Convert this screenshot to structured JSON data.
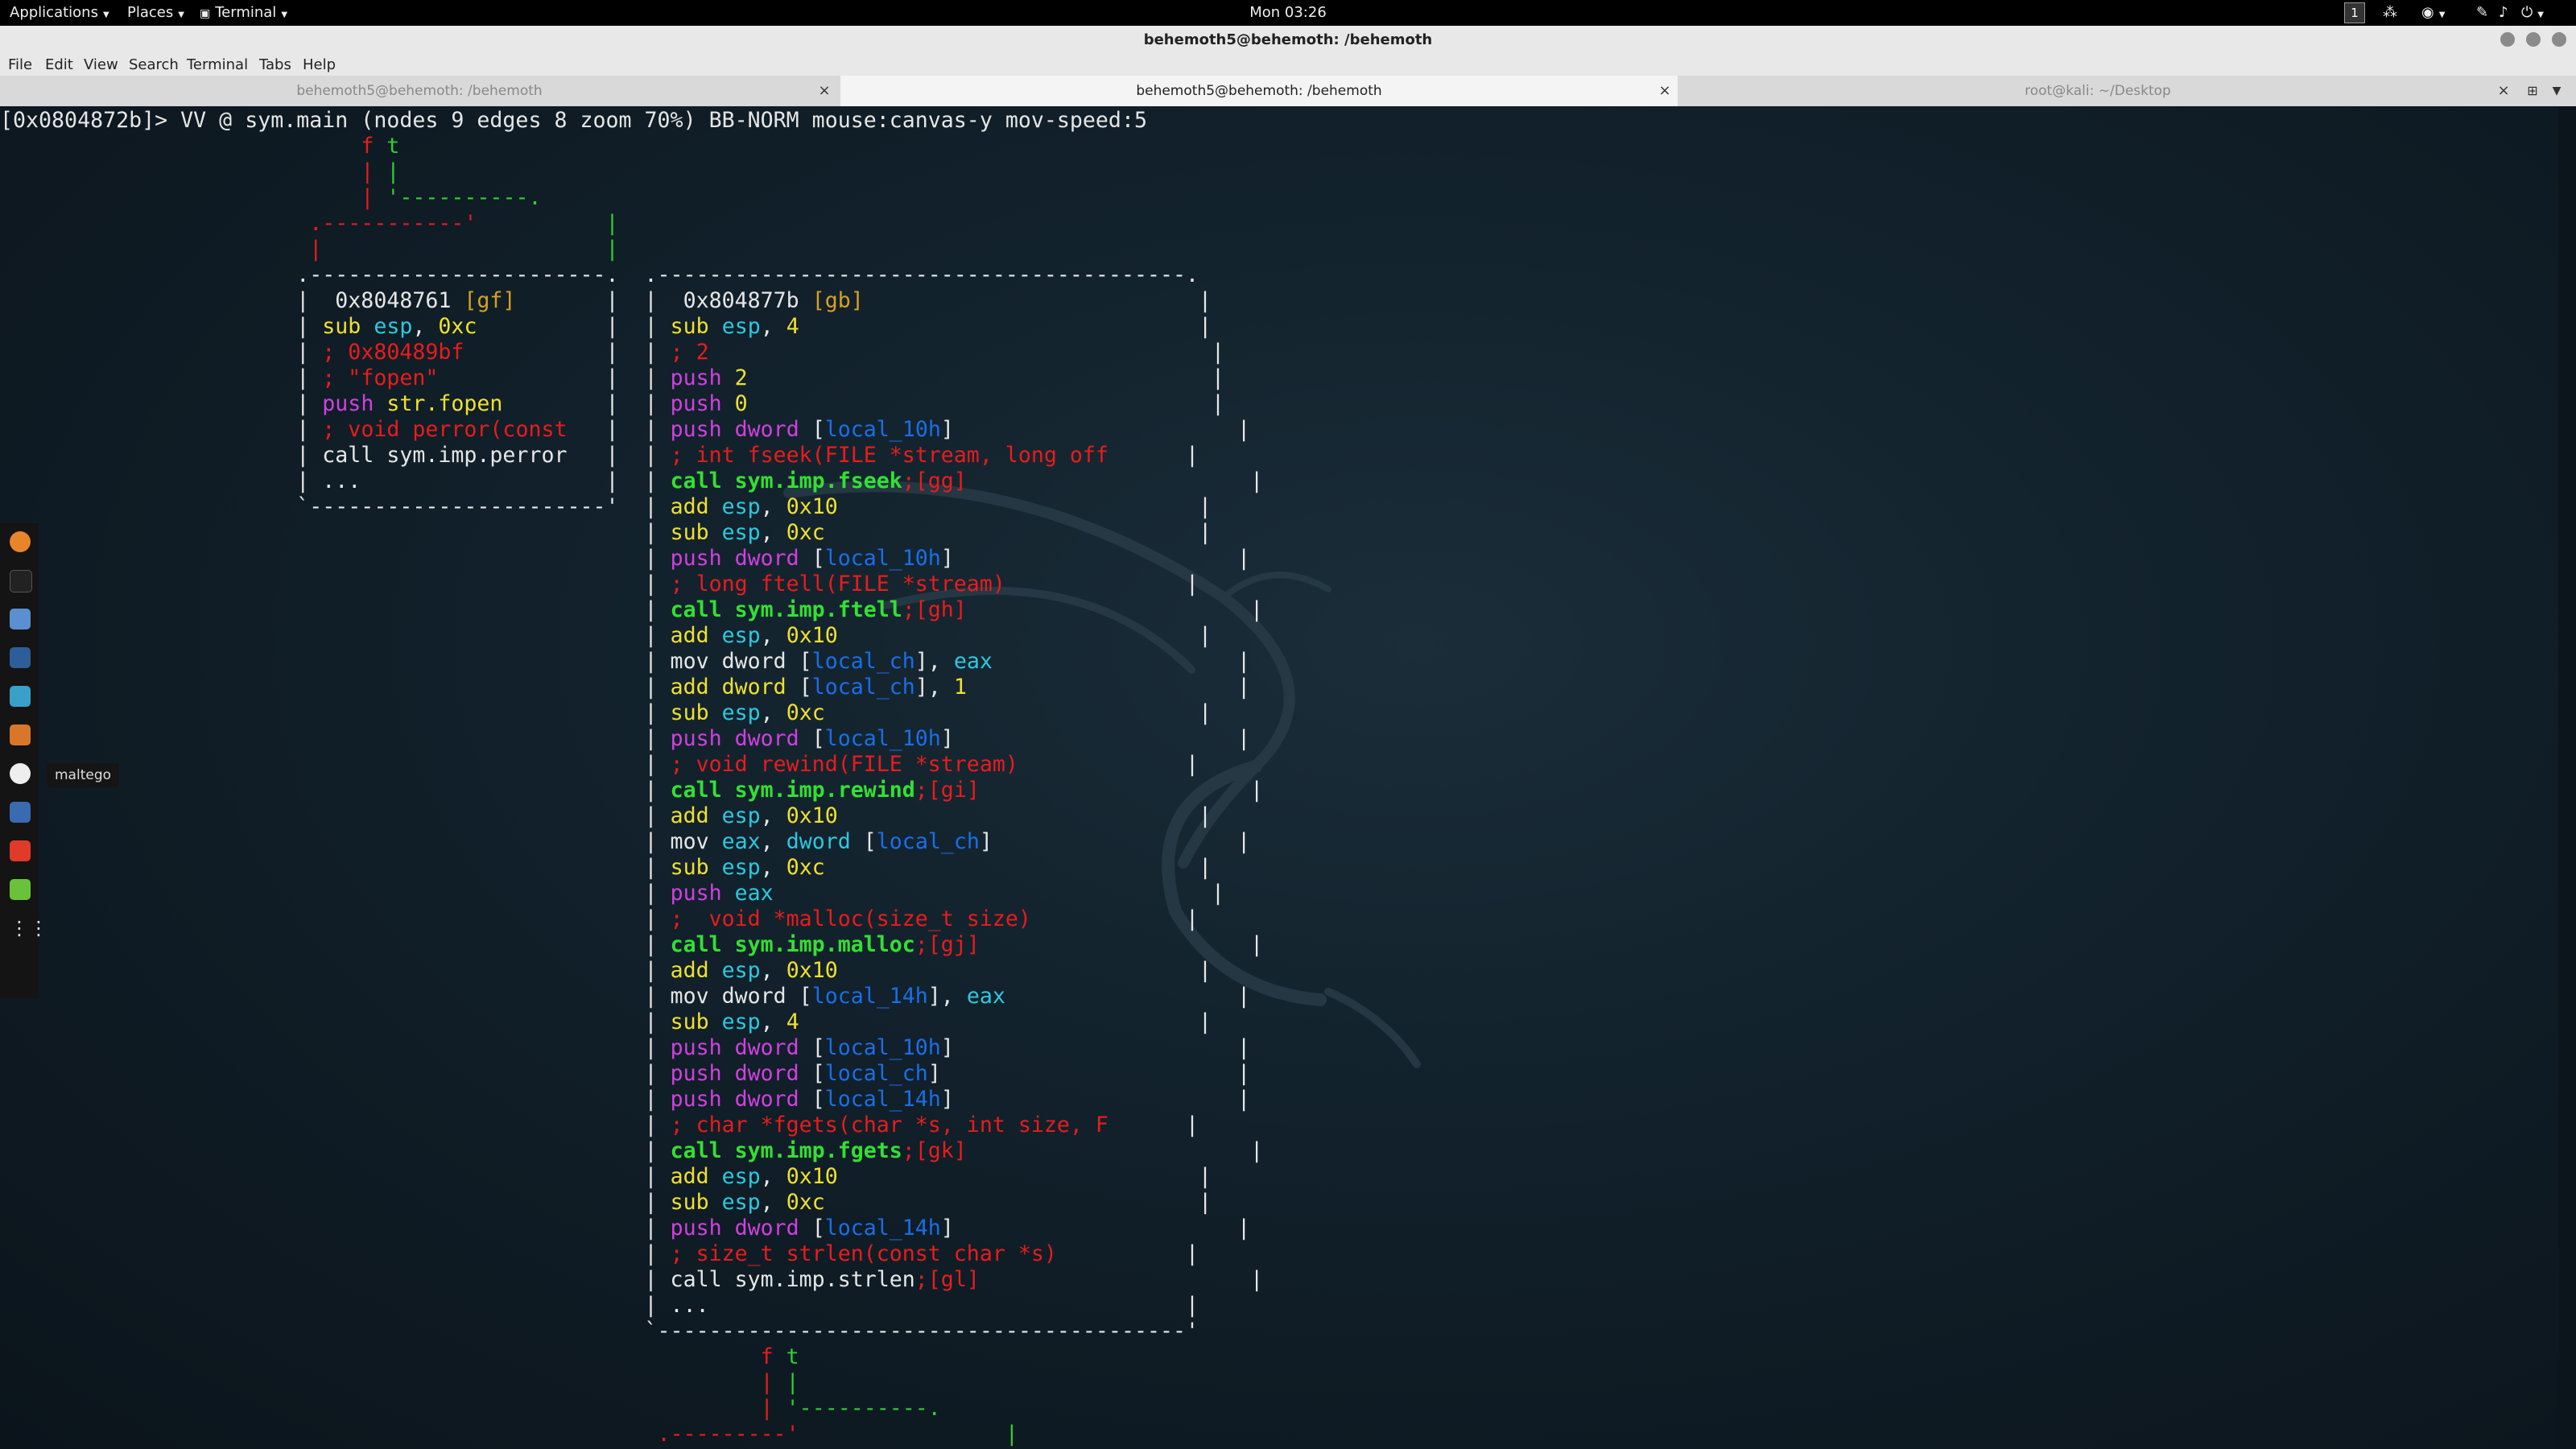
{
  "topbar": {
    "applications": "Applications",
    "places": "Places",
    "terminal": "Terminal",
    "clock": "Mon 03:26",
    "workspace": "1"
  },
  "window": {
    "title": "behemoth5@behemoth: /behemoth"
  },
  "menubar": [
    "File",
    "Edit",
    "View",
    "Search",
    "Terminal",
    "Tabs",
    "Help"
  ],
  "tabs": [
    {
      "label": "behemoth5@behemoth: /behemoth",
      "active": false
    },
    {
      "label": "behemoth5@behemoth: /behemoth",
      "active": true
    },
    {
      "label": "root@kali: ~/Desktop",
      "active": false
    }
  ],
  "dock": {
    "tooltip": "maltego",
    "icons": [
      "firefox-icon",
      "terminal-icon",
      "files-icon",
      "metasploit-icon",
      "armitage-icon",
      "burpsuite-icon",
      "maltego-icon",
      "beef-icon",
      "faraday-icon",
      "leafpad-icon",
      "show-apps-icon"
    ]
  },
  "terminal": {
    "prompt_line": "[0x0804872b]> VV @ sym.main (nodes 9 edges 8 zoom 70%) BB-NORM mouse:canvas-y mov-speed:5",
    "graph_lines": [
      [
        {
          "t": "                            "
        },
        {
          "t": "f",
          "c": "r"
        },
        {
          "t": " "
        },
        {
          "t": "t",
          "c": "g"
        }
      ],
      [
        {
          "t": "                            "
        },
        {
          "t": "|",
          "c": "r"
        },
        {
          "t": " "
        },
        {
          "t": "|",
          "c": "g"
        }
      ],
      [
        {
          "t": "                            "
        },
        {
          "t": "|",
          "c": "r"
        },
        {
          "t": " "
        },
        {
          "t": "'----------.",
          "c": "g"
        }
      ],
      [
        {
          "t": "                        "
        },
        {
          "t": ".-----------'",
          "c": "r"
        },
        {
          "t": "          "
        },
        {
          "t": "|",
          "c": "g"
        }
      ],
      [
        {
          "t": "                        "
        },
        {
          "t": "|",
          "c": "r"
        },
        {
          "t": "                      "
        },
        {
          "t": "|",
          "c": "g"
        }
      ],
      [
        {
          "t": "                       .-----------------------.  .-----------------------------------------."
        }
      ],
      [
        {
          "t": "                       |  0x8048761 "
        },
        {
          "t": "[gf]",
          "c": "o"
        },
        {
          "t": "       |  |  0x804877b "
        },
        {
          "t": "[gb]",
          "c": "o"
        },
        {
          "t": "                          |"
        }
      ],
      [
        {
          "t": "                       | "
        },
        {
          "t": "sub",
          "c": "y"
        },
        {
          "t": " "
        },
        {
          "t": "esp",
          "c": "c"
        },
        {
          "t": ", "
        },
        {
          "t": "0xc",
          "c": "y"
        },
        {
          "t": "          |  | "
        },
        {
          "t": "sub",
          "c": "y"
        },
        {
          "t": " "
        },
        {
          "t": "esp",
          "c": "c"
        },
        {
          "t": ", "
        },
        {
          "t": "4",
          "c": "y"
        },
        {
          "t": "                               |"
        }
      ],
      [
        {
          "t": "                       | "
        },
        {
          "t": "; 0x80489bf",
          "c": "r"
        },
        {
          "t": "           |  | "
        },
        {
          "t": "; 2",
          "c": "r"
        },
        {
          "t": "                                       |"
        }
      ],
      [
        {
          "t": "                       | "
        },
        {
          "t": "; \"fopen\"",
          "c": "r"
        },
        {
          "t": "             |  | "
        },
        {
          "t": "push",
          "c": "m"
        },
        {
          "t": " "
        },
        {
          "t": "2",
          "c": "y"
        },
        {
          "t": "                                    |"
        }
      ],
      [
        {
          "t": "                       | "
        },
        {
          "t": "push",
          "c": "m"
        },
        {
          "t": " "
        },
        {
          "t": "str.fopen",
          "c": "y"
        },
        {
          "t": "        |  | "
        },
        {
          "t": "push",
          "c": "m"
        },
        {
          "t": " "
        },
        {
          "t": "0",
          "c": "y"
        },
        {
          "t": "                                    |"
        }
      ],
      [
        {
          "t": "                       | "
        },
        {
          "t": "; void perror(const",
          "c": "r"
        },
        {
          "t": "   |  | "
        },
        {
          "t": "push",
          "c": "m"
        },
        {
          "t": " "
        },
        {
          "t": "dword",
          "c": "m"
        },
        {
          "t": " ["
        },
        {
          "t": "local_10h",
          "c": "b"
        },
        {
          "t": "]"
        },
        {
          "t": "                      |"
        }
      ],
      [
        {
          "t": "                       | call sym.imp.perror   |  | "
        },
        {
          "t": "; int fseek(FILE *stream, long off",
          "c": "r"
        },
        {
          "t": "      |"
        }
      ],
      [
        {
          "t": "                       | ...                   |  | "
        },
        {
          "t": "call sym.imp.fseek",
          "c": "gb"
        },
        {
          "t": ";[gg]",
          "c": "r"
        },
        {
          "t": "                      |"
        }
      ],
      [
        {
          "t": "                       `-----------------------'  | "
        },
        {
          "t": "add",
          "c": "y"
        },
        {
          "t": " "
        },
        {
          "t": "esp",
          "c": "c"
        },
        {
          "t": ", "
        },
        {
          "t": "0x10",
          "c": "y"
        },
        {
          "t": "                            |"
        }
      ],
      [
        {
          "t": "                                                  | "
        },
        {
          "t": "sub",
          "c": "y"
        },
        {
          "t": " "
        },
        {
          "t": "esp",
          "c": "c"
        },
        {
          "t": ", "
        },
        {
          "t": "0xc",
          "c": "y"
        },
        {
          "t": "                             |"
        }
      ],
      [
        {
          "t": "                                                  | "
        },
        {
          "t": "push",
          "c": "m"
        },
        {
          "t": " "
        },
        {
          "t": "dword",
          "c": "m"
        },
        {
          "t": " ["
        },
        {
          "t": "local_10h",
          "c": "b"
        },
        {
          "t": "]"
        },
        {
          "t": "                      |"
        }
      ],
      [
        {
          "t": "                                                  | "
        },
        {
          "t": "; long ftell(FILE *stream)",
          "c": "r"
        },
        {
          "t": "              |"
        }
      ],
      [
        {
          "t": "                                                  | "
        },
        {
          "t": "call sym.imp.ftell",
          "c": "gb"
        },
        {
          "t": ";[gh]",
          "c": "r"
        },
        {
          "t": "                      |"
        }
      ],
      [
        {
          "t": "                                                  | "
        },
        {
          "t": "add",
          "c": "y"
        },
        {
          "t": " "
        },
        {
          "t": "esp",
          "c": "c"
        },
        {
          "t": ", "
        },
        {
          "t": "0x10",
          "c": "y"
        },
        {
          "t": "                            |"
        }
      ],
      [
        {
          "t": "                                                  | mov dword ["
        },
        {
          "t": "local_ch",
          "c": "b"
        },
        {
          "t": "], "
        },
        {
          "t": "eax",
          "c": "c"
        },
        {
          "t": "                   |"
        }
      ],
      [
        {
          "t": "                                                  | "
        },
        {
          "t": "add",
          "c": "y"
        },
        {
          "t": " "
        },
        {
          "t": "dword",
          "c": "y"
        },
        {
          "t": " ["
        },
        {
          "t": "local_ch",
          "c": "b"
        },
        {
          "t": "], "
        },
        {
          "t": "1",
          "c": "y"
        },
        {
          "t": "                     |"
        }
      ],
      [
        {
          "t": "                                                  | "
        },
        {
          "t": "sub",
          "c": "y"
        },
        {
          "t": " "
        },
        {
          "t": "esp",
          "c": "c"
        },
        {
          "t": ", "
        },
        {
          "t": "0xc",
          "c": "y"
        },
        {
          "t": "                             |"
        }
      ],
      [
        {
          "t": "                                                  | "
        },
        {
          "t": "push",
          "c": "m"
        },
        {
          "t": " "
        },
        {
          "t": "dword",
          "c": "m"
        },
        {
          "t": " ["
        },
        {
          "t": "local_10h",
          "c": "b"
        },
        {
          "t": "]"
        },
        {
          "t": "                      |"
        }
      ],
      [
        {
          "t": "                                                  | "
        },
        {
          "t": "; void rewind(FILE *stream)",
          "c": "r"
        },
        {
          "t": "             |"
        }
      ],
      [
        {
          "t": "                                                  | "
        },
        {
          "t": "call sym.imp.rewind",
          "c": "gb"
        },
        {
          "t": ";[gi]",
          "c": "r"
        },
        {
          "t": "                     |"
        }
      ],
      [
        {
          "t": "                                                  | "
        },
        {
          "t": "add",
          "c": "y"
        },
        {
          "t": " "
        },
        {
          "t": "esp",
          "c": "c"
        },
        {
          "t": ", "
        },
        {
          "t": "0x10",
          "c": "y"
        },
        {
          "t": "                            |"
        }
      ],
      [
        {
          "t": "                                                  | mov "
        },
        {
          "t": "eax",
          "c": "c"
        },
        {
          "t": ", "
        },
        {
          "t": "dword",
          "c": "c"
        },
        {
          "t": " ["
        },
        {
          "t": "local_ch",
          "c": "b"
        },
        {
          "t": "]"
        },
        {
          "t": "                   |"
        }
      ],
      [
        {
          "t": "                                                  | "
        },
        {
          "t": "sub",
          "c": "y"
        },
        {
          "t": " "
        },
        {
          "t": "esp",
          "c": "c"
        },
        {
          "t": ", "
        },
        {
          "t": "0xc",
          "c": "y"
        },
        {
          "t": "                             |"
        }
      ],
      [
        {
          "t": "                                                  | "
        },
        {
          "t": "push",
          "c": "m"
        },
        {
          "t": " "
        },
        {
          "t": "eax",
          "c": "c"
        },
        {
          "t": "                                  |"
        }
      ],
      [
        {
          "t": "                                                  | "
        },
        {
          "t": ";  void *malloc(size_t size)",
          "c": "r"
        },
        {
          "t": "            |"
        }
      ],
      [
        {
          "t": "                                                  | "
        },
        {
          "t": "call sym.imp.malloc",
          "c": "gb"
        },
        {
          "t": ";[gj]",
          "c": "r"
        },
        {
          "t": "                     |"
        }
      ],
      [
        {
          "t": "                                                  | "
        },
        {
          "t": "add",
          "c": "y"
        },
        {
          "t": " "
        },
        {
          "t": "esp",
          "c": "c"
        },
        {
          "t": ", "
        },
        {
          "t": "0x10",
          "c": "y"
        },
        {
          "t": "                            |"
        }
      ],
      [
        {
          "t": "                                                  | mov dword ["
        },
        {
          "t": "local_14h",
          "c": "b"
        },
        {
          "t": "], "
        },
        {
          "t": "eax",
          "c": "c"
        },
        {
          "t": "                  |"
        }
      ],
      [
        {
          "t": "                                                  | "
        },
        {
          "t": "sub",
          "c": "y"
        },
        {
          "t": " "
        },
        {
          "t": "esp",
          "c": "c"
        },
        {
          "t": ", "
        },
        {
          "t": "4",
          "c": "y"
        },
        {
          "t": "                               |"
        }
      ],
      [
        {
          "t": "                                                  | "
        },
        {
          "t": "push",
          "c": "m"
        },
        {
          "t": " "
        },
        {
          "t": "dword",
          "c": "m"
        },
        {
          "t": " ["
        },
        {
          "t": "local_10h",
          "c": "b"
        },
        {
          "t": "]"
        },
        {
          "t": "                      |"
        }
      ],
      [
        {
          "t": "                                                  | "
        },
        {
          "t": "push",
          "c": "m"
        },
        {
          "t": " "
        },
        {
          "t": "dword",
          "c": "m"
        },
        {
          "t": " ["
        },
        {
          "t": "local_ch",
          "c": "b"
        },
        {
          "t": "]"
        },
        {
          "t": "                       |"
        }
      ],
      [
        {
          "t": "                                                  | "
        },
        {
          "t": "push",
          "c": "m"
        },
        {
          "t": " "
        },
        {
          "t": "dword",
          "c": "m"
        },
        {
          "t": " ["
        },
        {
          "t": "local_14h",
          "c": "b"
        },
        {
          "t": "]"
        },
        {
          "t": "                      |"
        }
      ],
      [
        {
          "t": "                                                  | "
        },
        {
          "t": "; char *fgets(char *s, int size, F",
          "c": "r"
        },
        {
          "t": "      |"
        }
      ],
      [
        {
          "t": "                                                  | "
        },
        {
          "t": "call sym.imp.fgets",
          "c": "gb"
        },
        {
          "t": ";[gk]",
          "c": "r"
        },
        {
          "t": "                      |"
        }
      ],
      [
        {
          "t": "                                                  | "
        },
        {
          "t": "add",
          "c": "y"
        },
        {
          "t": " "
        },
        {
          "t": "esp",
          "c": "c"
        },
        {
          "t": ", "
        },
        {
          "t": "0x10",
          "c": "y"
        },
        {
          "t": "                            |"
        }
      ],
      [
        {
          "t": "                                                  | "
        },
        {
          "t": "sub",
          "c": "y"
        },
        {
          "t": " "
        },
        {
          "t": "esp",
          "c": "c"
        },
        {
          "t": ", "
        },
        {
          "t": "0xc",
          "c": "y"
        },
        {
          "t": "                             |"
        }
      ],
      [
        {
          "t": "                                                  | "
        },
        {
          "t": "push",
          "c": "m"
        },
        {
          "t": " "
        },
        {
          "t": "dword",
          "c": "m"
        },
        {
          "t": " ["
        },
        {
          "t": "local_14h",
          "c": "b"
        },
        {
          "t": "]"
        },
        {
          "t": "                      |"
        }
      ],
      [
        {
          "t": "                                                  | "
        },
        {
          "t": "; size_t strlen(const char *s)",
          "c": "r"
        },
        {
          "t": "          |"
        }
      ],
      [
        {
          "t": "                                                  | call sym.imp.strlen"
        },
        {
          "t": ";[gl]",
          "c": "r"
        },
        {
          "t": "                     |"
        }
      ],
      [
        {
          "t": "                                                  | ...                                     |"
        }
      ],
      [
        {
          "t": "                                                  `-----------------------------------------'"
        }
      ],
      [
        {
          "t": "                                                           "
        },
        {
          "t": "f",
          "c": "r"
        },
        {
          "t": " "
        },
        {
          "t": "t",
          "c": "g"
        }
      ],
      [
        {
          "t": "                                                           "
        },
        {
          "t": "|",
          "c": "r"
        },
        {
          "t": " "
        },
        {
          "t": "|",
          "c": "g"
        }
      ],
      [
        {
          "t": "                                                           "
        },
        {
          "t": "|",
          "c": "r"
        },
        {
          "t": " "
        },
        {
          "t": "'----------.",
          "c": "g"
        }
      ],
      [
        {
          "t": "                                                   "
        },
        {
          "t": ".---------'",
          "c": "r"
        },
        {
          "t": "                "
        },
        {
          "t": "|",
          "c": "g"
        }
      ]
    ]
  }
}
